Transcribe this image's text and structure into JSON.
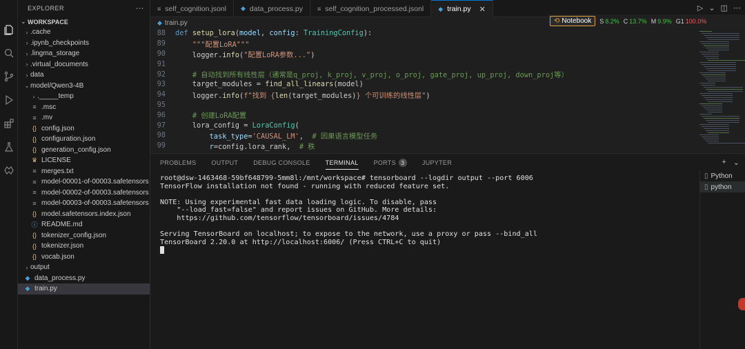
{
  "activity_bar": [
    "files-icon",
    "search-icon",
    "source-control-icon",
    "run-debug-icon",
    "extensions-icon",
    "flask-icon",
    "dsw-icon"
  ],
  "sidebar": {
    "title": "EXPLORER",
    "workspace": "WORKSPACE",
    "items": [
      {
        "label": ".cache",
        "kind": "folder",
        "indent": 1
      },
      {
        "label": ".ipynb_checkpoints",
        "kind": "folder",
        "indent": 1
      },
      {
        "label": ".lingma_storage",
        "kind": "folder",
        "indent": 1
      },
      {
        "label": ".virtual_documents",
        "kind": "folder",
        "indent": 1
      },
      {
        "label": "data",
        "kind": "folder",
        "indent": 1
      },
      {
        "label": "model/Qwen3-4B",
        "kind": "folder-open",
        "indent": 1
      },
      {
        "label": "._____temp",
        "kind": "folder",
        "indent": 2
      },
      {
        "label": ".msc",
        "kind": "file",
        "indent": 2
      },
      {
        "label": ".mv",
        "kind": "file",
        "indent": 2
      },
      {
        "label": "config.json",
        "kind": "json",
        "indent": 2
      },
      {
        "label": "configuration.json",
        "kind": "json",
        "indent": 2
      },
      {
        "label": "generation_config.json",
        "kind": "json",
        "indent": 2
      },
      {
        "label": "LICENSE",
        "kind": "license",
        "indent": 2
      },
      {
        "label": "merges.txt",
        "kind": "file",
        "indent": 2
      },
      {
        "label": "model-00001-of-00003.safetensors",
        "kind": "file",
        "indent": 2
      },
      {
        "label": "model-00002-of-00003.safetensors",
        "kind": "file",
        "indent": 2
      },
      {
        "label": "model-00003-of-00003.safetensors",
        "kind": "file",
        "indent": 2
      },
      {
        "label": "model.safetensors.index.json",
        "kind": "json",
        "indent": 2
      },
      {
        "label": "README.md",
        "kind": "info",
        "indent": 2
      },
      {
        "label": "tokenizer_config.json",
        "kind": "json",
        "indent": 2
      },
      {
        "label": "tokenizer.json",
        "kind": "json",
        "indent": 2
      },
      {
        "label": "vocab.json",
        "kind": "json",
        "indent": 2
      },
      {
        "label": "output",
        "kind": "folder",
        "indent": 1
      },
      {
        "label": "data_process.py",
        "kind": "py",
        "indent": 1
      },
      {
        "label": "train.py",
        "kind": "py",
        "indent": 1,
        "selected": true
      }
    ]
  },
  "tabs": [
    {
      "label": "self_cognition.jsonl",
      "active": false
    },
    {
      "label": "data_process.py",
      "active": false
    },
    {
      "label": "self_cognition_processed.jsonl",
      "active": false
    },
    {
      "label": "train.py",
      "active": true
    }
  ],
  "breadcrumb": "train.py",
  "notebook": {
    "button": "Notebook",
    "metrics": [
      {
        "label": "S",
        "value": "8.2%",
        "color": "green"
      },
      {
        "label": "C",
        "value": "13.7%",
        "color": "green"
      },
      {
        "label": "M",
        "value": "9.9%",
        "color": "green"
      },
      {
        "label": "G1",
        "value": "100.0%",
        "color": "red"
      }
    ]
  },
  "code_lines": [
    {
      "n": "88",
      "html": "<span class='k'>def</span> <span class='f'>setup_lora</span>(<span class='v'>model</span>, <span class='v'>config</span>: <span class='t'>TrainingConfig</span>):"
    },
    {
      "n": "89",
      "html": "    <span class='s'>\"\"\"配置LoRA\"\"\"</span>"
    },
    {
      "n": "90",
      "html": "    logger.<span class='f'>info</span>(<span class='s'>\"配置LoRA参数...\"</span>)"
    },
    {
      "n": "91",
      "html": ""
    },
    {
      "n": "92",
      "html": "    <span class='cm'># 自动找到所有线性层（通常是q_proj, k_proj, v_proj, o_proj, gate_proj, up_proj, down_proj等）</span>"
    },
    {
      "n": "93",
      "html": "    target_modules = <span class='f'>find_all_linears</span>(model)"
    },
    {
      "n": "94",
      "html": "    logger.<span class='f'>info</span>(<span class='s'>f\"找到 {</span><span class='f'>len</span>(target_modules)<span class='s'>} 个可训练的线性层\"</span>)"
    },
    {
      "n": "95",
      "html": ""
    },
    {
      "n": "96",
      "html": "    <span class='cm'># 创建LoRA配置</span>"
    },
    {
      "n": "97",
      "html": "    lora_config = <span class='t'>LoraConfig</span>("
    },
    {
      "n": "98",
      "html": "        <span class='v'>task_type</span>=<span class='s'>'CAUSAL_LM'</span>,  <span class='cm'># 因果语言模型任务</span>"
    },
    {
      "n": "99",
      "html": "        <span class='v'>r</span>=config.lora_rank,  <span class='cm'># 秩</span>"
    }
  ],
  "panel": {
    "tabs": [
      {
        "label": "PROBLEMS"
      },
      {
        "label": "OUTPUT"
      },
      {
        "label": "DEBUG CONSOLE"
      },
      {
        "label": "TERMINAL",
        "active": true
      },
      {
        "label": "PORTS",
        "badge": "3"
      },
      {
        "label": "JUPYTER"
      }
    ],
    "terminal_lines": [
      "root@dsw-1463468-59bf648799-5mm8l:/mnt/workspace# tensorboard --logdir output --port 6006",
      "TensorFlow installation not found - running with reduced feature set.",
      "",
      "NOTE: Using experimental fast data loading logic. To disable, pass",
      "    \"--load_fast=false\" and report issues on GitHub. More details:",
      "    https://github.com/tensorflow/tensorboard/issues/4784",
      "",
      "Serving TensorBoard on localhost; to expose to the network, use a proxy or pass --bind_all",
      "TensorBoard 2.20.0 at http://localhost:6006/ (Press CTRL+C to quit)"
    ],
    "terminal_list": [
      {
        "label": "Python",
        "active": false
      },
      {
        "label": "python",
        "active": true
      }
    ]
  }
}
